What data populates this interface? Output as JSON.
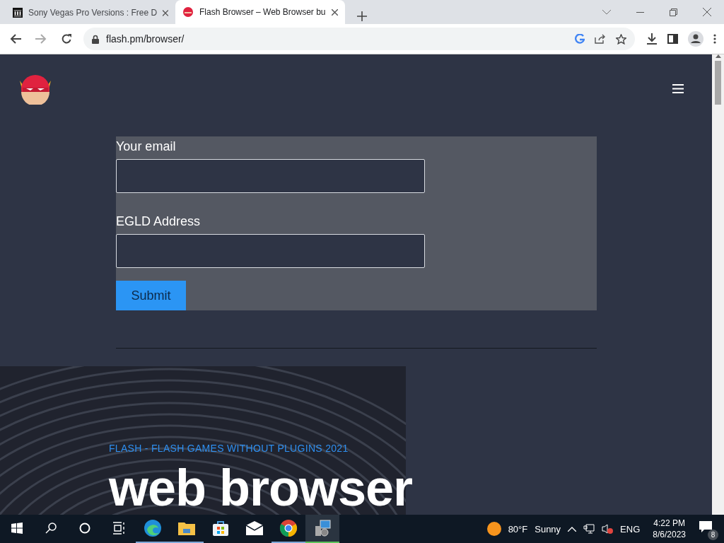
{
  "browser": {
    "tabs": [
      {
        "title": "Sony Vegas Pro Versions : Free D",
        "kind": "archive",
        "selected": false
      },
      {
        "title": "Flash Browser – Web Browser bu",
        "kind": "flash",
        "selected": true
      }
    ],
    "address": {
      "url": "flash.pm/browser/"
    }
  },
  "page": {
    "form": {
      "fields": [
        {
          "label": "Your email"
        },
        {
          "label": "EGLD Address"
        }
      ],
      "submit": "Submit"
    },
    "hero": {
      "eyebrow": "FLASH - FLASH GAMES WITHOUT PLUGINS 2021",
      "heading": "web browser"
    }
  },
  "taskbar": {
    "apps": [
      {
        "kind": "edge",
        "running": true,
        "active": false
      },
      {
        "kind": "folder",
        "running": true,
        "active": false
      },
      {
        "kind": "store",
        "running": false,
        "active": false
      },
      {
        "kind": "mail",
        "running": false,
        "active": false
      },
      {
        "kind": "chrome",
        "running": true,
        "active": false
      },
      {
        "kind": "installer",
        "running": true,
        "active": true
      }
    ],
    "weather": {
      "temp": "80°F",
      "condition": "Sunny"
    },
    "language": "ENG",
    "time": "4:22 PM",
    "date": "8/6/2023",
    "notifications": "8"
  }
}
